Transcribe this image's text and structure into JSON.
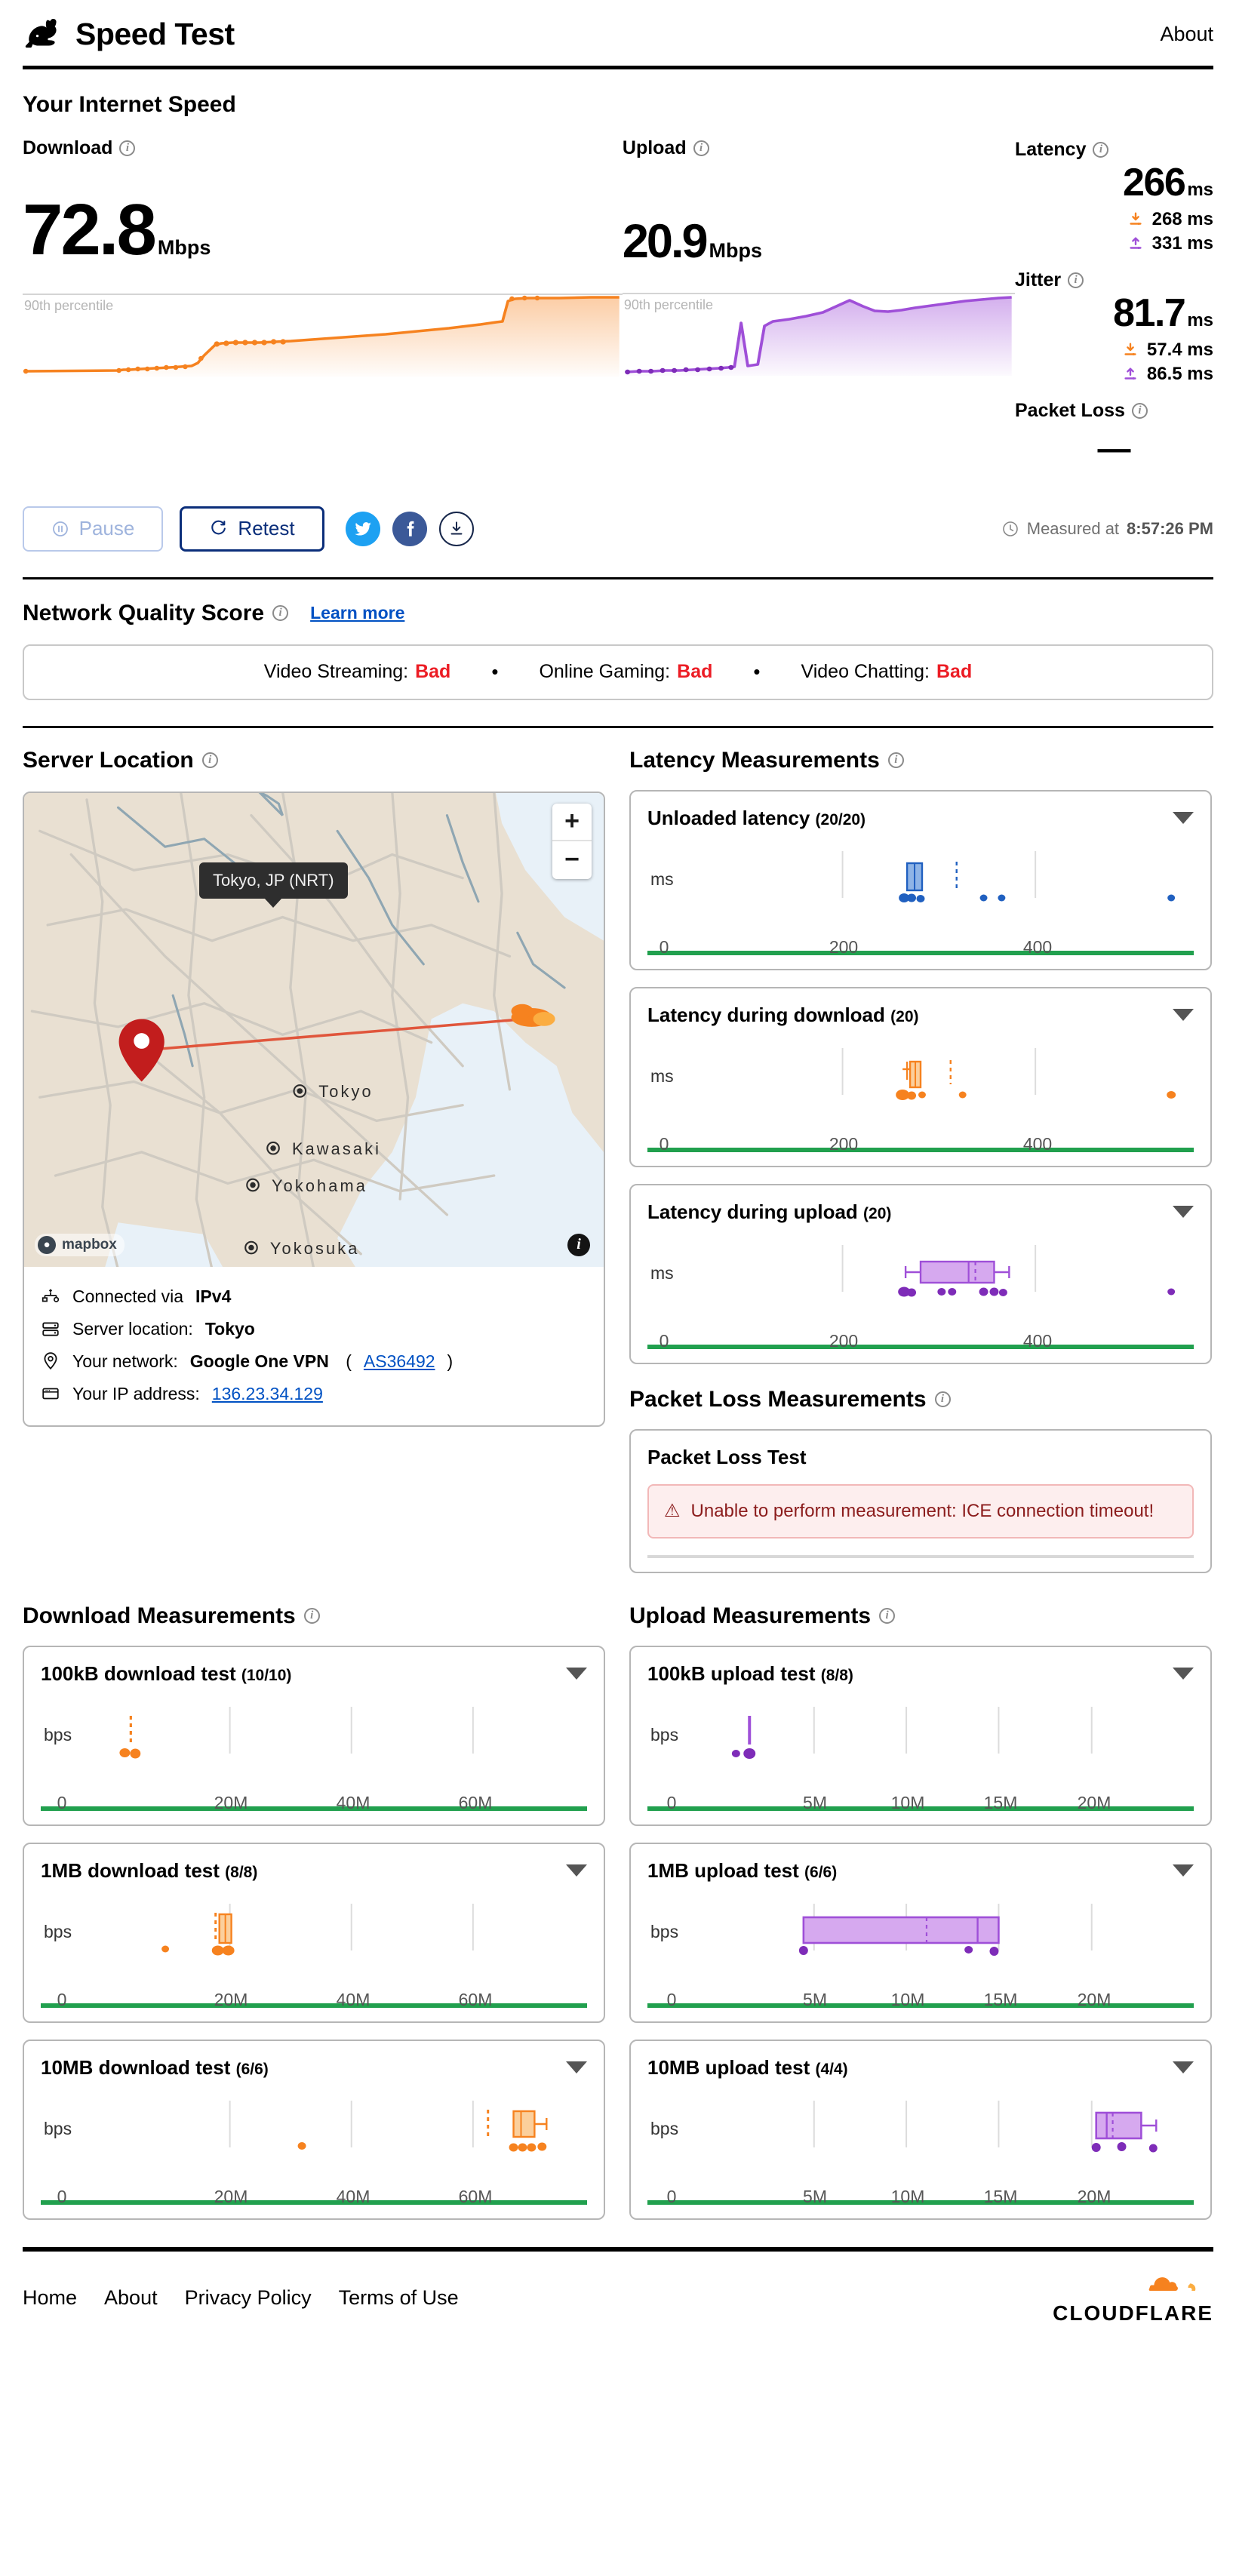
{
  "header": {
    "logo_icon": "rabbit-icon",
    "title": "Speed Test",
    "about_label": "About"
  },
  "speed_section": {
    "title": "Your Internet Speed",
    "download": {
      "label": "Download",
      "value": "72.8",
      "unit": "Mbps",
      "percentile_label": "90th percentile",
      "color": "#f6821f"
    },
    "upload": {
      "label": "Upload",
      "value": "20.9",
      "unit": "Mbps",
      "percentile_label": "90th percentile",
      "color": "#9f4fd8"
    },
    "latency": {
      "label": "Latency",
      "value": "266",
      "unit": "ms",
      "download_value": "268 ms",
      "upload_value": "331 ms"
    },
    "jitter": {
      "label": "Jitter",
      "value": "81.7",
      "unit": "ms",
      "download_value": "57.4 ms",
      "upload_value": "86.5 ms"
    },
    "packet_loss": {
      "label": "Packet Loss",
      "value": "—"
    }
  },
  "controls": {
    "pause_label": "Pause",
    "retest_label": "Retest",
    "twitter_icon": "twitter-icon",
    "facebook_icon": "facebook-icon",
    "download_icon": "download-icon",
    "measured_prefix": "Measured at",
    "measured_time": "8:57:26 PM"
  },
  "network_quality": {
    "title": "Network Quality Score",
    "learn_more": "Learn more",
    "items": [
      {
        "label": "Video Streaming:",
        "value": "Bad"
      },
      {
        "label": "Online Gaming:",
        "value": "Bad"
      },
      {
        "label": "Video Chatting:",
        "value": "Bad"
      }
    ],
    "bad_color": "#ec1c24",
    "separator": "•"
  },
  "server_location": {
    "title": "Server Location",
    "tooltip": "Tokyo, JP (NRT)",
    "zoom_in": "+",
    "zoom_out": "−",
    "attribution": "mapbox",
    "city_labels": [
      "Tokyo",
      "Kawasaki",
      "Yokohama",
      "Yokosuka"
    ],
    "details": [
      {
        "icon": "network-icon",
        "text_prefix": "Connected via ",
        "value": "IPv4"
      },
      {
        "icon": "server-icon",
        "text_prefix": "Server location: ",
        "value": "Tokyo"
      },
      {
        "icon": "pin-icon",
        "text_prefix": "Your network: ",
        "value": "Google One VPN",
        "link": "AS36492"
      },
      {
        "icon": "ip-icon",
        "text_prefix": "Your IP address: ",
        "link": "136.23.34.129"
      }
    ]
  },
  "latency_measurements": {
    "title": "Latency Measurements",
    "cards": [
      {
        "title": "Unloaded latency",
        "count": "(20/20)",
        "unit": "ms",
        "ticks": [
          "0",
          "200",
          "400"
        ],
        "color": "#2060c0"
      },
      {
        "title": "Latency during download",
        "count": "(20)",
        "unit": "ms",
        "ticks": [
          "0",
          "200",
          "400"
        ],
        "color": "#f6821f"
      },
      {
        "title": "Latency during upload",
        "count": "(20)",
        "unit": "ms",
        "ticks": [
          "0",
          "200",
          "400"
        ],
        "color": "#9f4fd8"
      }
    ]
  },
  "packet_loss_measurements": {
    "title": "Packet Loss Measurements",
    "card_title": "Packet Loss Test",
    "error_text": "Unable to perform measurement: ICE connection timeout!"
  },
  "download_measurements": {
    "title": "Download Measurements",
    "cards": [
      {
        "title": "100kB download test",
        "count": "(10/10)",
        "unit": "bps",
        "ticks": [
          "0",
          "20M",
          "40M",
          "60M"
        ]
      },
      {
        "title": "1MB download test",
        "count": "(8/8)",
        "unit": "bps",
        "ticks": [
          "0",
          "20M",
          "40M",
          "60M"
        ]
      },
      {
        "title": "10MB download test",
        "count": "(6/6)",
        "unit": "bps",
        "ticks": [
          "0",
          "20M",
          "40M",
          "60M"
        ]
      }
    ]
  },
  "upload_measurements": {
    "title": "Upload Measurements",
    "cards": [
      {
        "title": "100kB upload test",
        "count": "(8/8)",
        "unit": "bps",
        "ticks": [
          "0",
          "5M",
          "10M",
          "15M",
          "20M"
        ]
      },
      {
        "title": "1MB upload test",
        "count": "(6/6)",
        "unit": "bps",
        "ticks": [
          "0",
          "5M",
          "10M",
          "15M",
          "20M"
        ]
      },
      {
        "title": "10MB upload test",
        "count": "(4/4)",
        "unit": "bps",
        "ticks": [
          "0",
          "5M",
          "10M",
          "15M",
          "20M"
        ]
      }
    ]
  },
  "footer": {
    "links": [
      "Home",
      "About",
      "Privacy Policy",
      "Terms of Use"
    ],
    "brand": "CLOUDFLARE"
  },
  "chart_data": [
    {
      "type": "area",
      "title": "Download throughput over time",
      "ylabel": "Mbps",
      "xlabel": "",
      "annotation": "90th percentile",
      "ylim": [
        0,
        80
      ],
      "color": "#f6821f",
      "x": [
        0,
        4,
        8,
        12,
        16,
        20,
        24,
        28,
        30,
        32,
        34,
        36,
        38,
        40,
        42,
        44,
        46,
        48,
        52,
        56,
        60,
        64,
        68,
        72,
        76,
        80,
        84,
        86,
        88,
        90,
        92,
        96,
        100
      ],
      "values": [
        1.5,
        1.6,
        1.6,
        1.7,
        1.7,
        1.8,
        1.8,
        2.0,
        2.4,
        3.0,
        4.0,
        8.0,
        17.5,
        19.0,
        19.5,
        19.8,
        20.0,
        20.4,
        21.0,
        21.6,
        22.2,
        23.0,
        23.8,
        24.6,
        25.6,
        26.6,
        27.8,
        29.0,
        62.0,
        69.0,
        71.0,
        72.3,
        72.8
      ]
    },
    {
      "type": "area",
      "title": "Upload throughput over time",
      "ylabel": "Mbps",
      "xlabel": "",
      "annotation": "90th percentile",
      "ylim": [
        0,
        26
      ],
      "color": "#9f4fd8",
      "x": [
        0,
        4,
        8,
        12,
        16,
        20,
        24,
        28,
        32,
        34,
        36,
        38,
        40,
        44,
        48,
        52,
        56,
        60,
        64,
        68,
        72,
        76,
        80,
        84,
        88,
        92,
        96,
        100
      ],
      "values": [
        0.6,
        0.7,
        0.8,
        0.9,
        1.0,
        1.1,
        1.2,
        1.3,
        1.5,
        9.0,
        3.0,
        2.8,
        12.5,
        13.5,
        14.5,
        16.0,
        18.5,
        20.6,
        20.0,
        19.2,
        18.8,
        18.9,
        19.3,
        19.8,
        20.2,
        20.5,
        20.7,
        20.9
      ]
    },
    {
      "type": "box",
      "title": "Unloaded latency (20/20)",
      "unit": "ms",
      "xlim": [
        0,
        520
      ],
      "ticks": [
        0,
        200,
        400
      ],
      "color": "#2060c0",
      "q1": 258,
      "median": 262,
      "q3": 275,
      "whisker_low": 255,
      "whisker_high": 278,
      "mean": 300,
      "points": [
        256,
        257,
        258,
        258,
        259,
        260,
        260,
        261,
        262,
        263,
        264,
        266,
        268,
        270,
        272,
        274,
        276,
        278,
        310,
        330,
        345,
        500
      ]
    },
    {
      "type": "box",
      "title": "Latency during download (20)",
      "unit": "ms",
      "xlim": [
        0,
        520
      ],
      "ticks": [
        0,
        200,
        400
      ],
      "color": "#f6821f",
      "q1": 256,
      "median": 262,
      "q3": 272,
      "whisker_low": 250,
      "whisker_high": 280,
      "mean": 297,
      "points": [
        250,
        252,
        254,
        255,
        256,
        258,
        259,
        260,
        262,
        264,
        266,
        268,
        270,
        272,
        275,
        278,
        288,
        325,
        500
      ]
    },
    {
      "type": "box",
      "title": "Latency during upload (20)",
      "unit": "ms",
      "xlim": [
        0,
        520
      ],
      "ticks": [
        0,
        200,
        400
      ],
      "color": "#9f4fd8",
      "q1": 268,
      "median": 330,
      "q3": 372,
      "whisker_low": 255,
      "whisker_high": 385,
      "mean": 340,
      "points": [
        258,
        260,
        262,
        264,
        266,
        268,
        295,
        305,
        350,
        358,
        362,
        366,
        370,
        372,
        375,
        500
      ]
    },
    {
      "type": "box",
      "title": "100kB download test (10/10)",
      "unit": "bps",
      "xlim": [
        0,
        72000000
      ],
      "ticks": [
        0,
        20000000,
        40000000,
        60000000
      ],
      "color": "#f6821f",
      "q1": 2400000,
      "median": 2800000,
      "q3": 3100000,
      "whisker_low": 2200000,
      "whisker_high": 3400000,
      "mean": 2900000,
      "points": [
        2100000,
        2600000,
        3000000,
        3200000
      ]
    },
    {
      "type": "box",
      "title": "1MB download test (8/8)",
      "unit": "bps",
      "xlim": [
        0,
        72000000
      ],
      "ticks": [
        0,
        20000000,
        40000000,
        60000000
      ],
      "color": "#f6821f",
      "q1": 17500000,
      "median": 18200000,
      "q3": 19500000,
      "whisker_low": 16800000,
      "whisker_high": 20200000,
      "mean": 18400000,
      "points": [
        9500000,
        17200000,
        17800000,
        18200000,
        18800000,
        19400000
      ]
    },
    {
      "type": "box",
      "title": "10MB download test (6/6)",
      "unit": "bps",
      "xlim": [
        0,
        72000000
      ],
      "ticks": [
        0,
        20000000,
        40000000,
        60000000
      ],
      "color": "#f6821f",
      "q1": 66500000,
      "median": 68000000,
      "q3": 70000000,
      "whisker_low": 65500000,
      "whisker_high": 71500000,
      "mean": 62500000,
      "points": [
        33000000,
        66000000,
        67200000,
        68500000,
        69500000,
        70500000
      ]
    },
    {
      "type": "box",
      "title": "100kB upload test (8/8)",
      "unit": "bps",
      "xlim": [
        0,
        23000000
      ],
      "ticks": [
        0,
        5000000,
        10000000,
        15000000,
        20000000
      ],
      "color": "#9f4fd8",
      "q1": 1300000,
      "median": 1450000,
      "q3": 1600000,
      "whisker_low": 1200000,
      "whisker_high": 1700000,
      "mean": 1500000,
      "points": [
        1000000,
        1450000
      ]
    },
    {
      "type": "box",
      "title": "1MB upload test (6/6)",
      "unit": "bps",
      "xlim": [
        0,
        23000000
      ],
      "ticks": [
        0,
        5000000,
        10000000,
        15000000,
        20000000
      ],
      "color": "#9f4fd8",
      "q1": 4700000,
      "median": 10200000,
      "q3": 14600000,
      "whisker_low": 4700000,
      "whisker_high": 14600000,
      "mean": 10200000,
      "points": [
        4800000,
        13200000,
        14500000
      ]
    },
    {
      "type": "box",
      "title": "10MB upload test (4/4)",
      "unit": "bps",
      "xlim": [
        0,
        23000000
      ],
      "ticks": [
        0,
        5000000,
        10000000,
        15000000,
        20000000
      ],
      "color": "#9f4fd8",
      "q1": 20200000,
      "median": 20700000,
      "q3": 21500000,
      "whisker_low": 20200000,
      "whisker_high": 22200000,
      "mean": 20900000,
      "points": [
        20100000,
        20900000,
        22100000
      ]
    }
  ]
}
